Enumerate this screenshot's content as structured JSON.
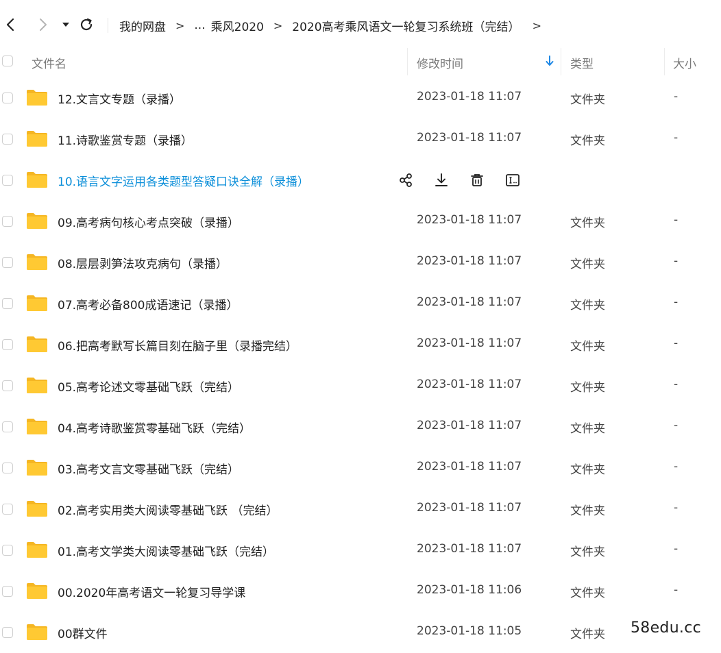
{
  "toolbar": {
    "back_icon": "chevron-left-icon",
    "forward_icon": "chevron-right-icon",
    "history_icon": "caret-down-icon",
    "refresh_icon": "refresh-icon"
  },
  "breadcrumb": {
    "root": "我的网盘",
    "sep": ">",
    "ellipsis": "...",
    "items": [
      "乘风2020",
      "2020高考乘风语文一轮复习系统班（完结）"
    ]
  },
  "columns": {
    "name": "文件名",
    "modified": "修改时间",
    "type": "类型",
    "size": "大小",
    "sort_icon": "arrow-down-icon"
  },
  "files": [
    {
      "name": "12.文言文专题（录播）",
      "time": "2023-01-18 11:07",
      "type": "文件夹",
      "size": "-"
    },
    {
      "name": "11.诗歌鉴赏专题（录播）",
      "time": "2023-01-18 11:07",
      "type": "文件夹",
      "size": "-"
    },
    {
      "name": "10.语言文字运用各类题型答疑口诀全解（录播）",
      "time": "",
      "type": "",
      "size": ""
    },
    {
      "name": "09.高考病句核心考点突破（录播）",
      "time": "2023-01-18 11:07",
      "type": "文件夹",
      "size": "-"
    },
    {
      "name": "08.层层剥笋法攻克病句（录播）",
      "time": "2023-01-18 11:07",
      "type": "文件夹",
      "size": "-"
    },
    {
      "name": "07.高考必备800成语速记（录播）",
      "time": "2023-01-18 11:07",
      "type": "文件夹",
      "size": "-"
    },
    {
      "name": "06.把高考默写长篇目刻在脑子里（录播完结）",
      "time": "2023-01-18 11:07",
      "type": "文件夹",
      "size": "-"
    },
    {
      "name": "05.高考论述文零基础飞跃（完结）",
      "time": "2023-01-18 11:07",
      "type": "文件夹",
      "size": "-"
    },
    {
      "name": "04.高考诗歌鉴赏零基础飞跃（完结）",
      "time": "2023-01-18 11:07",
      "type": "文件夹",
      "size": "-"
    },
    {
      "name": "03.高考文言文零基础飞跃（完结）",
      "time": "2023-01-18 11:07",
      "type": "文件夹",
      "size": "-"
    },
    {
      "name": "02.高考实用类大阅读零基础飞跃 （完结）",
      "time": "2023-01-18 11:07",
      "type": "文件夹",
      "size": "-"
    },
    {
      "name": "01.高考文学类大阅读零基础飞跃（完结）",
      "time": "2023-01-18 11:07",
      "type": "文件夹",
      "size": "-"
    },
    {
      "name": "00.2020年高考语文一轮复习导学课",
      "time": "2023-01-18 11:06",
      "type": "文件夹",
      "size": "-"
    },
    {
      "name": "00群文件",
      "time": "2023-01-18 11:05",
      "type": "文件夹",
      "size": ""
    }
  ],
  "hover_actions": [
    "share-icon",
    "download-icon",
    "delete-icon",
    "rename-icon"
  ],
  "colors": {
    "folder": "#FFC933",
    "folder_dark": "#F5B623",
    "link_hover": "#0A8ED9",
    "sort_arrow": "#1E88E5"
  },
  "watermark": "58edu.cc"
}
